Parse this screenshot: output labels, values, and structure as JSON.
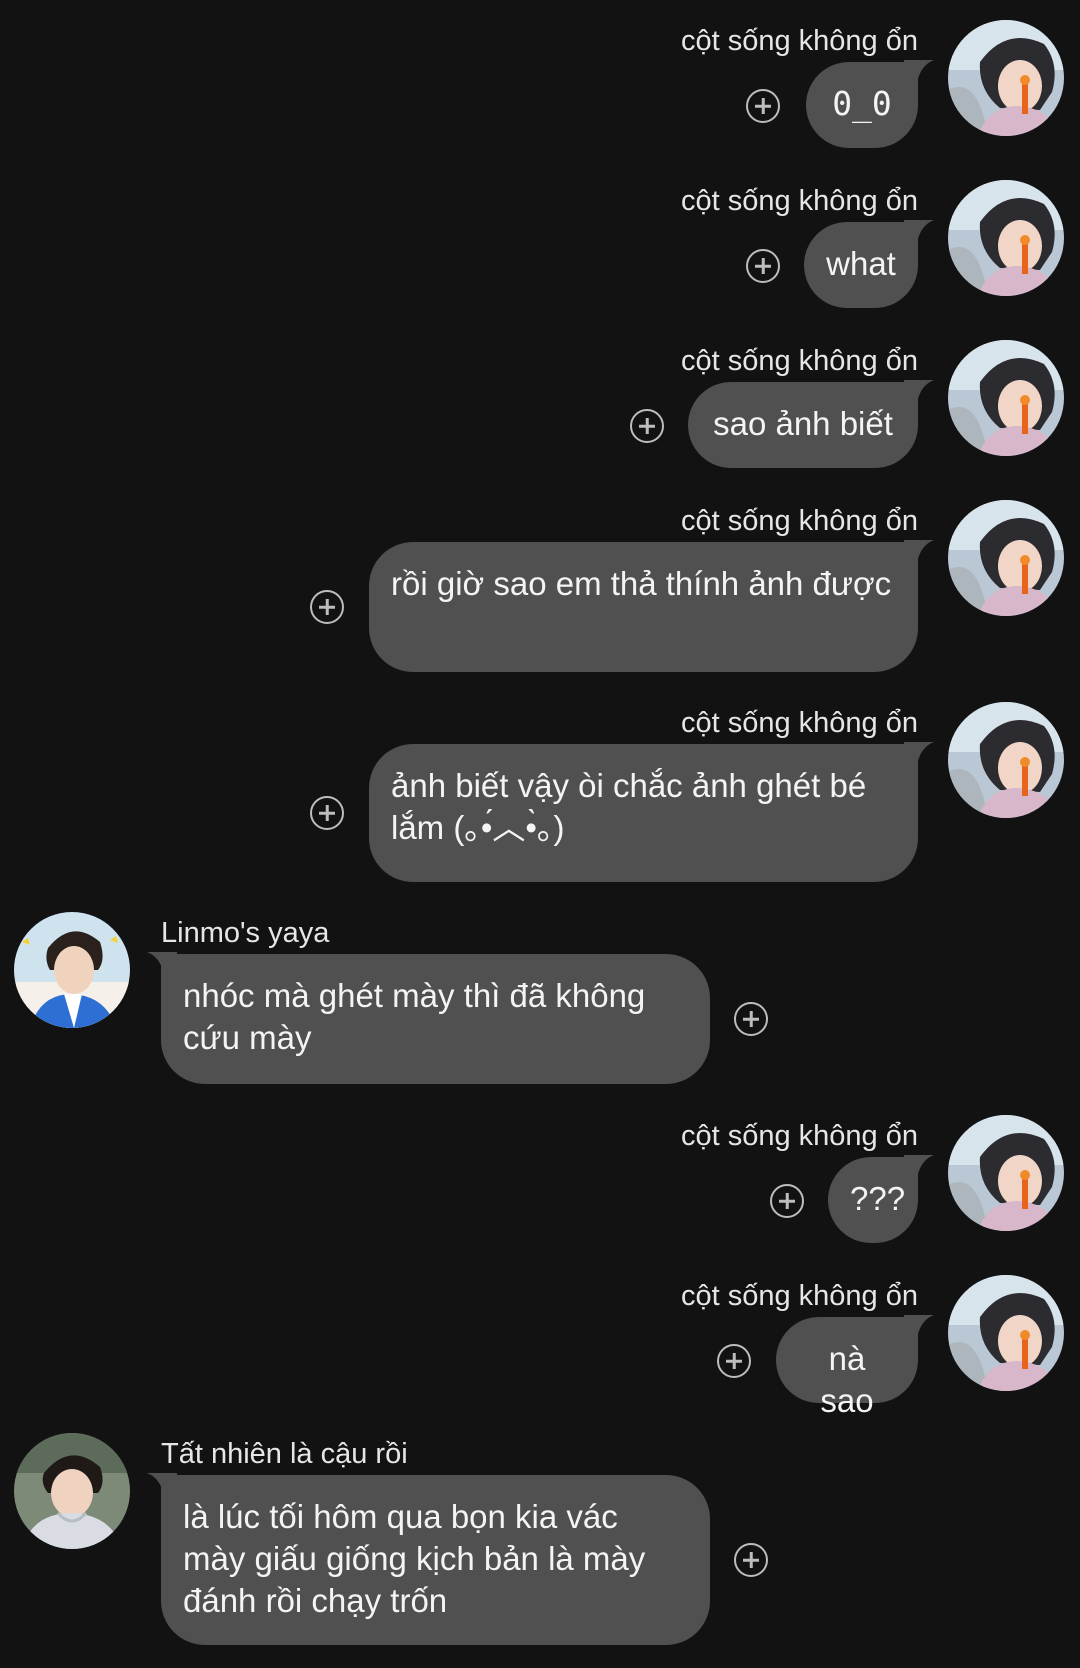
{
  "messages": [
    {
      "sender": "cột sống không ổn",
      "text": "0_0"
    },
    {
      "sender": "cột sống không ổn",
      "text": "what"
    },
    {
      "sender": "cột sống không ổn",
      "text": "sao ảnh biết"
    },
    {
      "sender": "cột sống không ổn",
      "text": "rồi giờ sao em thả thính ảnh được"
    },
    {
      "sender": "cột sống không ổn",
      "text": "ảnh biết vậy òi chắc ảnh ghét bé lắm (｡•́︿•̀｡)"
    },
    {
      "sender": "Linmo's yaya",
      "text": "nhóc mà ghét mày thì đã không cứu mày"
    },
    {
      "sender": "cột sống không ổn",
      "text": "???"
    },
    {
      "sender": "cột sống không ổn",
      "text": "nà sao"
    },
    {
      "sender": "Tất nhiên là cậu rồi",
      "text": "là lúc tối hôm qua bọn kia vác mày giấu giống kịch bản là mày đánh rồi chạy trốn"
    }
  ],
  "colors": {
    "background": "#121212",
    "bubble": "#505050",
    "text": "#f4f4f4",
    "react_icon": "#bdbdbd"
  },
  "icons": {
    "react": "add-reaction-icon",
    "avatar": "profile-photo"
  }
}
